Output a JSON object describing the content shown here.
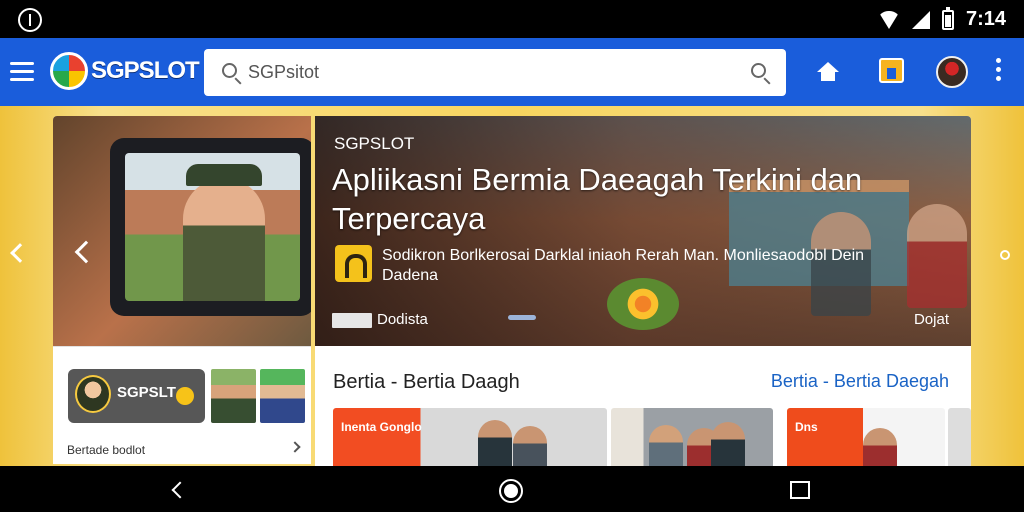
{
  "status_bar": {
    "time": "7:14",
    "icons": [
      "app-notification-icon",
      "wifi-icon",
      "signal-icon",
      "battery-icon"
    ]
  },
  "app_bar": {
    "logo_text": "SGPSLOT",
    "search": {
      "value": "SGPsitot",
      "placeholder": "SGPsitot"
    },
    "icons": [
      "menu-icon",
      "search-icon",
      "home-icon",
      "store-icon",
      "avatar",
      "more-icon"
    ]
  },
  "left_panel": {
    "promo_text": "SGPSLT",
    "caption": "Bertade bodlot"
  },
  "hero": {
    "kicker": "SGPSLOT",
    "title": "Apliikasni Bermia Daeagah Terkini dan Terpercaya",
    "body": "Sodikron Borlkerosai Darklal iniaoh Rerah Man. Monliesaodobl Dein Dadena",
    "left_action": "Dodista",
    "right_action": "Dojat"
  },
  "news": {
    "heading": "Bertia - Bertia Daagh",
    "link": "Bertia - Bertia Daegah",
    "cards": [
      {
        "tag": "Inenta Gonglo"
      },
      {
        "tag": ""
      },
      {
        "tag": "Dns"
      },
      {
        "tag": ""
      }
    ]
  },
  "colors": {
    "app_bar": "#1A5DDB",
    "background": "#F8D55F",
    "accent_link": "#1A63C5",
    "card_red": "#F24D22"
  }
}
